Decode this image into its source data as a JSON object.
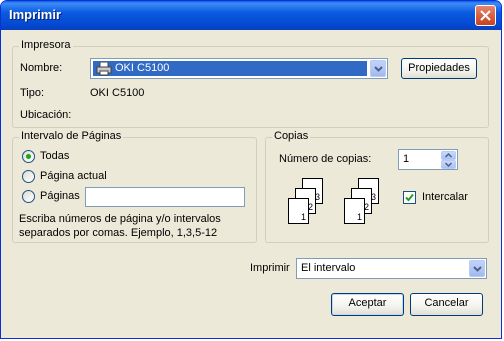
{
  "window": {
    "title": "Imprimir"
  },
  "printer_group": {
    "title": "Impresora",
    "name_label": "Nombre:",
    "name_value": "OKI C5100",
    "type_label": "Tipo:",
    "type_value": "OKI C5100",
    "location_label": "Ubicación:",
    "properties_button": "Propiedades"
  },
  "range_group": {
    "title": "Intervalo de Páginas",
    "option_all": "Todas",
    "option_current": "Página actual",
    "option_pages": "Páginas",
    "pages_value": "",
    "hint_line1": "Escriba números de página y/o intervalos",
    "hint_line2": "separados por comas.  Ejemplo, 1,3,5-12",
    "selected": "Todas"
  },
  "copies_group": {
    "title": "Copias",
    "count_label": "Número de copias:",
    "count_value": "1",
    "collate_label": "Intercalar",
    "collate_checked": true,
    "page_numbers": [
      "1",
      "2",
      "3"
    ]
  },
  "print_what": {
    "label": "Imprimir",
    "value": "El intervalo"
  },
  "footer": {
    "ok_button": "Aceptar",
    "cancel_button": "Cancelar"
  }
}
